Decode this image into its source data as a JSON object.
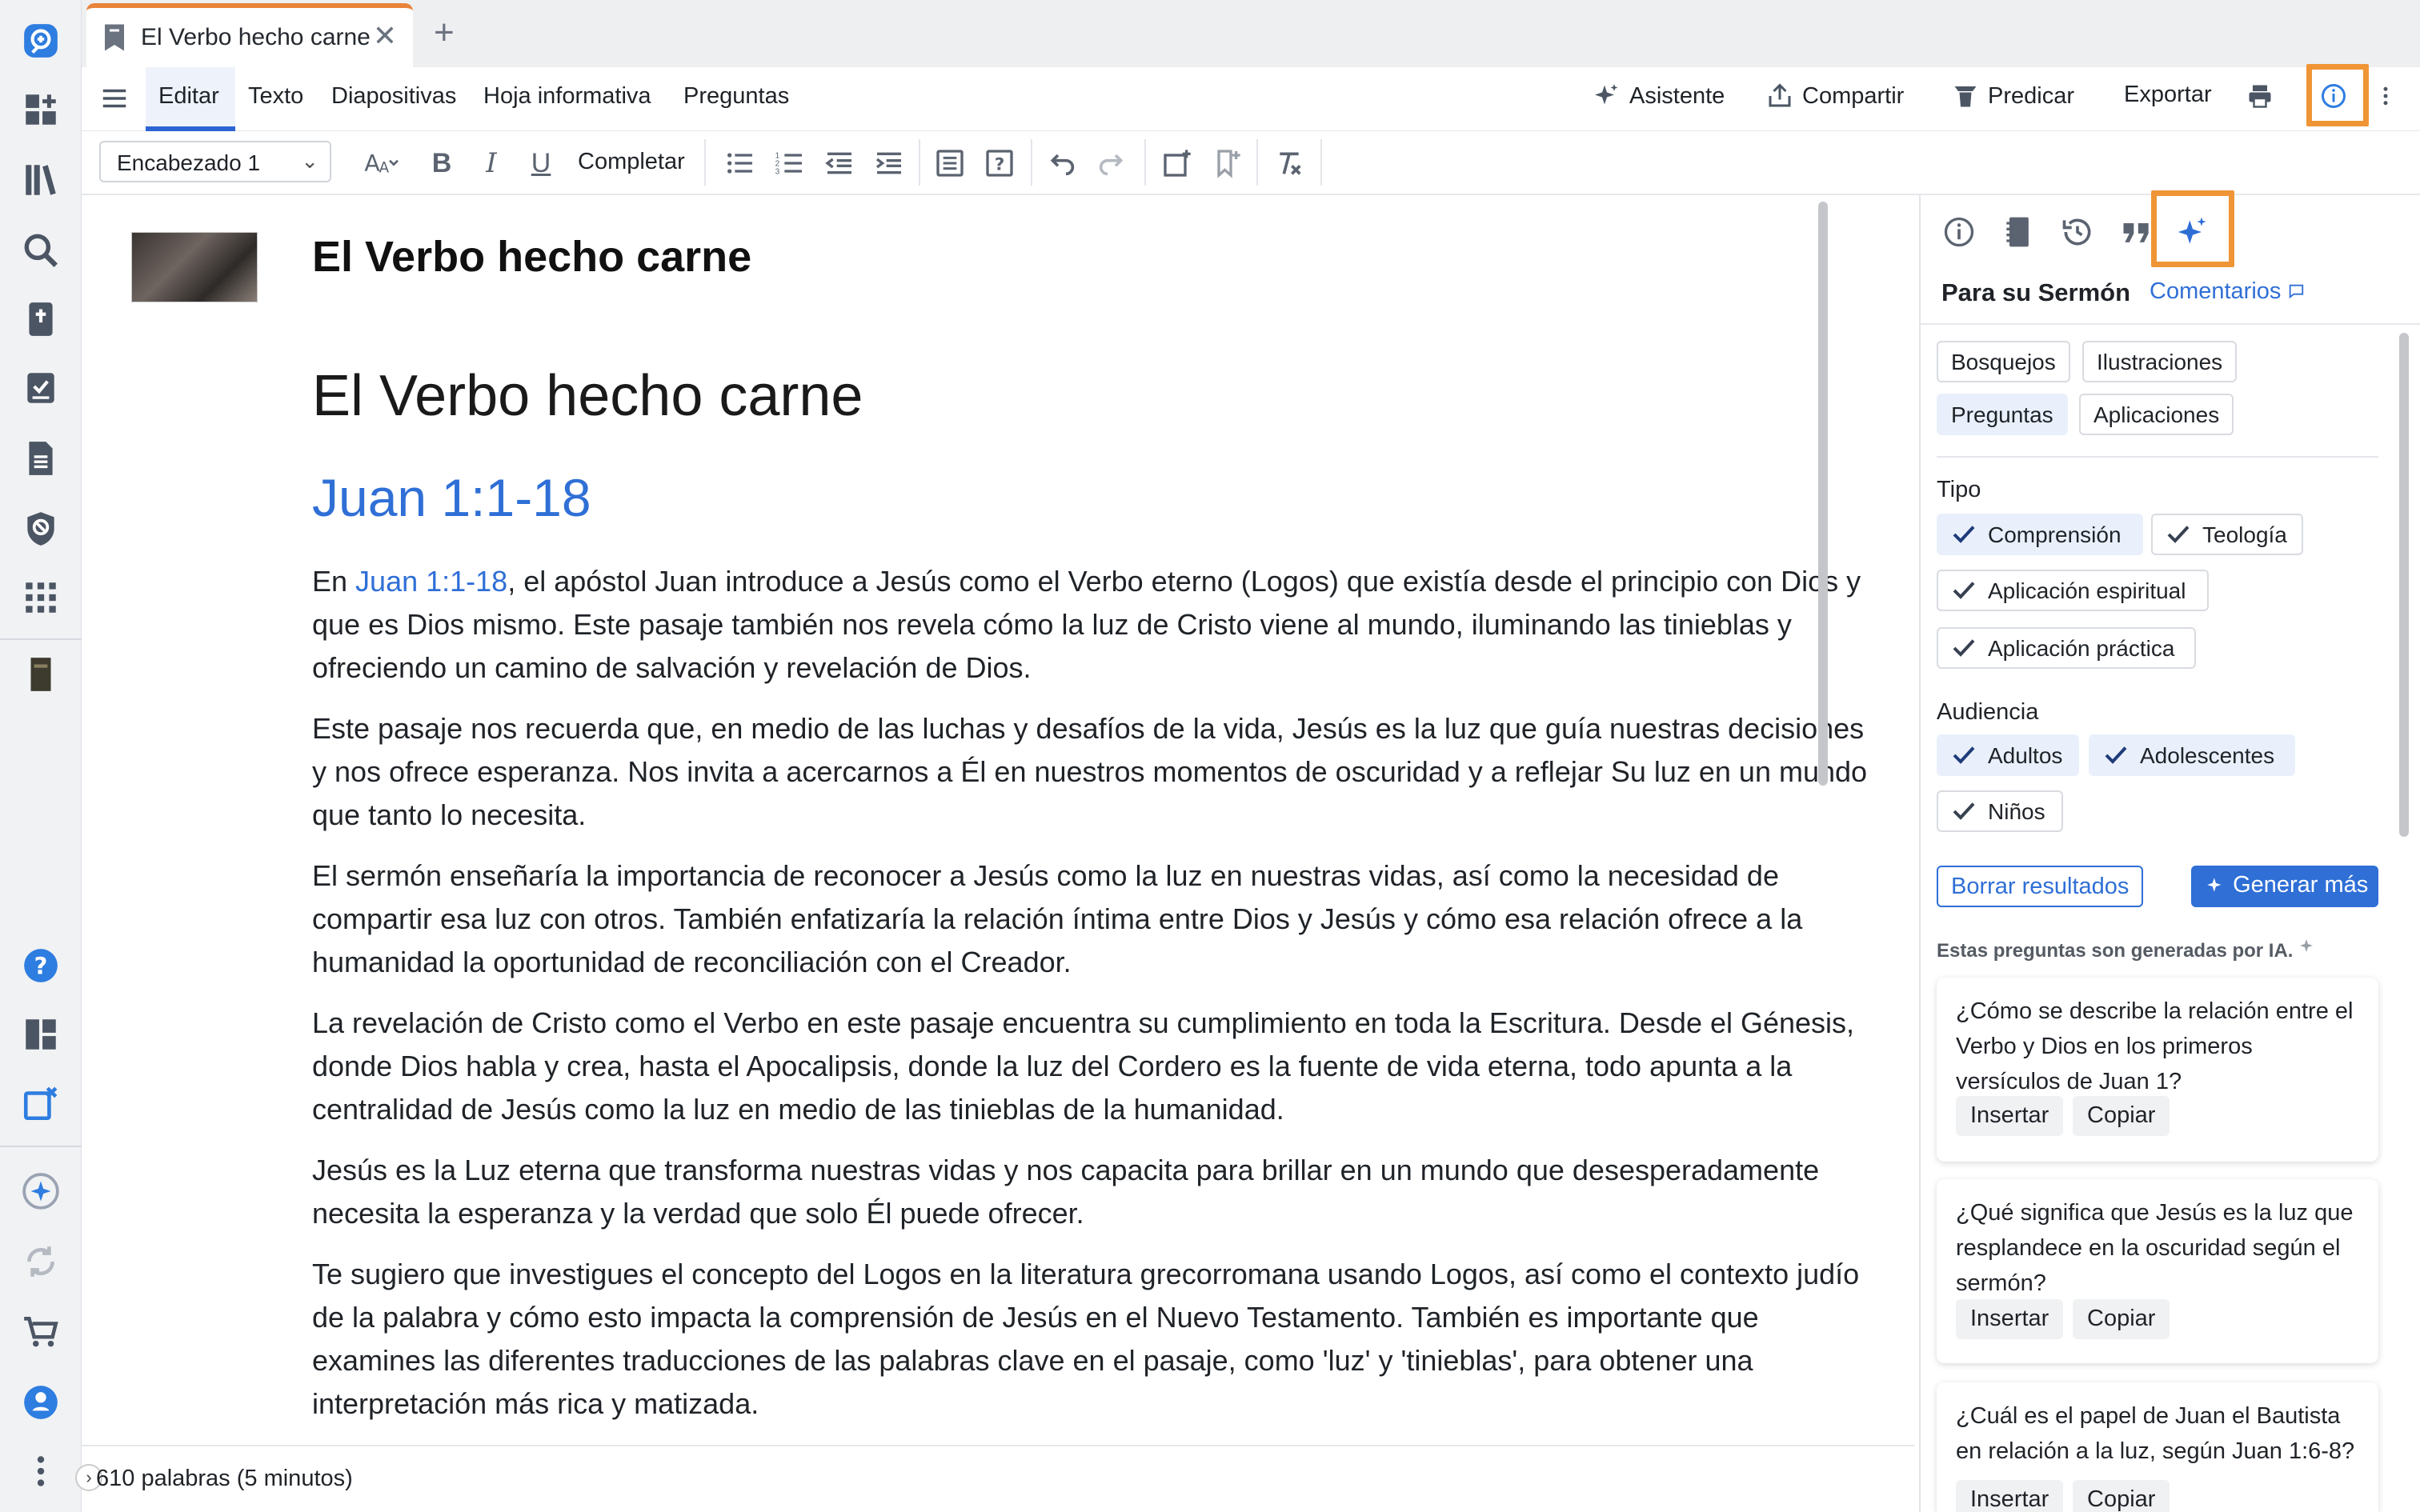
{
  "tab": {
    "title": "El Verbo hecho carne",
    "close": "✕",
    "new": "+"
  },
  "menu": {
    "items": [
      "Editar",
      "Texto",
      "Diapositivas",
      "Hoja informativa",
      "Preguntas"
    ],
    "right": {
      "assistant": "Asistente",
      "share": "Compartir",
      "preach": "Predicar",
      "export": "Exportar"
    }
  },
  "format": {
    "style": "Encabezado 1",
    "complete": "Completar",
    "bold": "B",
    "italic": "I",
    "underline": "U"
  },
  "doc": {
    "title": "El Verbo hecho carne",
    "heading1": "El Verbo hecho carne",
    "heading2": "Juan 1:1-18",
    "p1_pre": "En ",
    "p1_link": "Juan 1:1-18",
    "p1_post": ", el apóstol Juan introduce a Jesús como el Verbo eterno (Logos) que existía desde el principio con Dios y que es Dios mismo. Este pasaje también nos revela cómo la luz de Cristo viene al mundo, iluminando las tinieblas y ofreciendo un camino de salvación y revelación de Dios.",
    "p2": "Este pasaje nos recuerda que, en medio de las luchas y desafíos de la vida, Jesús es la luz que guía nuestras decisiones y nos ofrece esperanza. Nos invita a acercarnos a Él en nuestros momentos de oscuridad y a reflejar Su luz en un mundo que tanto lo necesita.",
    "p3": "El sermón enseñaría la importancia de reconocer a Jesús como la luz en nuestras vidas, así como la necesidad de compartir esa luz con otros. También enfatizaría la relación íntima entre Dios y Jesús y cómo esa relación ofrece a la humanidad la oportunidad de reconciliación con el Creador.",
    "p4": "La revelación de Cristo como el Verbo en este pasaje encuentra su cumplimiento en toda la Escritura. Desde el Génesis, donde Dios habla y crea, hasta el Apocalipsis, donde la luz del Cordero es la fuente de vida eterna, todo apunta a la centralidad de Jesús como la luz en medio de las tinieblas de la humanidad.",
    "p5": "Jesús es la Luz eterna que transforma nuestras vidas y nos capacita para brillar en un mundo que desesperadamente necesita la esperanza y la verdad que solo Él puede ofrecer.",
    "p6": "Te sugiero que investigues el concepto del Logos en la literatura grecorromana usando Logos, así como el contexto judío de la palabra y cómo esto impacta la comprensión de Jesús en el Nuevo Testamento. También es importante que examines las diferentes traducciones de las palabras clave en el pasaje, como 'luz' y 'tinieblas', para obtener una interpretación más rica y matizada."
  },
  "status": {
    "words": "610 palabras (5 minutos)",
    "expand": "›"
  },
  "panel": {
    "heading": "Para su Sermón",
    "comments": "Comentarios",
    "chips": [
      "Bosquejos",
      "Ilustraciones",
      "Preguntas",
      "Aplicaciones"
    ],
    "type_label": "Tipo",
    "types": [
      "Comprensión",
      "Teología",
      "Aplicación espiritual",
      "Aplicación práctica"
    ],
    "audience_label": "Audiencia",
    "audiences": [
      "Adultos",
      "Adolescentes",
      "Niños"
    ],
    "clear": "Borrar resultados",
    "generate": "Generar más",
    "ai_note": "Estas preguntas son generadas por IA.",
    "questions": [
      "¿Cómo se describe la relación entre el Verbo y Dios en los primeros versículos de Juan 1?",
      "¿Qué significa que Jesús es la luz que resplandece en la oscuridad según el sermón?",
      "¿Cuál es el papel de Juan el Bautista en relación a la luz, según Juan 1:6-8?"
    ],
    "insert": "Insertar",
    "copy": "Copiar"
  },
  "colors": {
    "accent": "#2f6fd6",
    "highlight": "#ef9536",
    "tab_accent": "#e8833a"
  }
}
